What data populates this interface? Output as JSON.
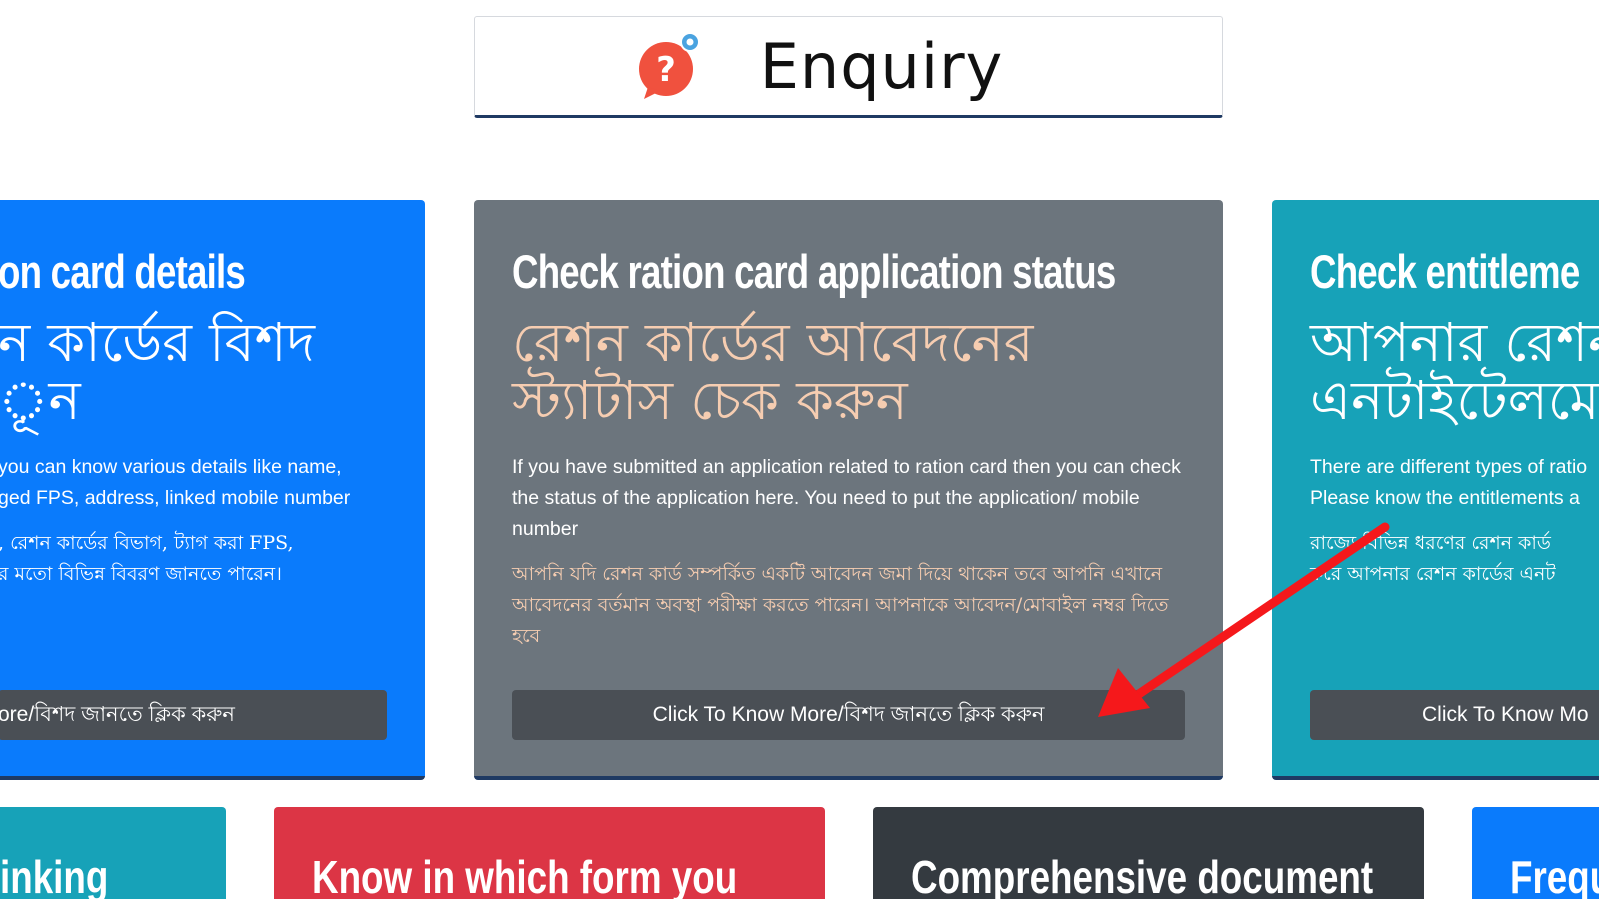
{
  "header": {
    "title": "Enquiry",
    "icon": "question-chat-icon"
  },
  "cards": [
    {
      "title": "on card details",
      "title_bn": "ন কার্ডের বিশদ\nূন",
      "desc": " you can know various details like name,\nged FPS, address, linked mobile number",
      "desc_bn": ", রেশন কার্ডের বিভাগ, ট্যাগ করা FPS,\nর মতো বিভিন্ন বিবরণ জানতে পারেন।",
      "button": "ore/বিশদ জানতে ক্লিক করুন",
      "color": "#0a7bfc"
    },
    {
      "title": "Check ration card application status",
      "title_bn": "রেশন কার্ডের আবেদনের\nস্ট্যাটাস চেক করুন",
      "desc": "If you have submitted an application related to ration card then you can check the status of the application here. You need to put the application/ mobile number",
      "desc_bn": "আপনি যদি রেশন কার্ড সম্পর্কিত একটি আবেদন জমা দিয়ে থাকেন তবে আপনি এখানে আবেদনের বর্তমান অবস্থা পরীক্ষা করতে পারেন। আপনাকে আবেদন/মোবাইল নম্বর দিতে হবে",
      "button": "Click To Know More/বিশদ জানতে ক্লিক করুন",
      "color": "#6c757d"
    },
    {
      "title": "Check entitleme",
      "title_bn": "আপনার রেশন\nএনটাইটেলমে",
      "desc": "There are different types of ratio\nPlease know the entitlements a",
      "desc_bn": "রাজ্যে বিভিন্ন ধরণের রেশন কার্ড \nকরে আপনার রেশন কার্ডের এনট",
      "button": "Click To Know Mo",
      "color": "#17a2b8"
    }
  ],
  "bottom_cards": [
    {
      "title": "inking",
      "color": "#17a2b8"
    },
    {
      "title": "Know in which form you",
      "color": "#dc3545"
    },
    {
      "title": "Comprehensive document",
      "color": "#343a40"
    },
    {
      "title": "Frequ",
      "color": "#0a7bfc"
    }
  ],
  "annotation": {
    "arrow_color": "#f5181b",
    "arrow_icon": "red-arrow-icon"
  }
}
